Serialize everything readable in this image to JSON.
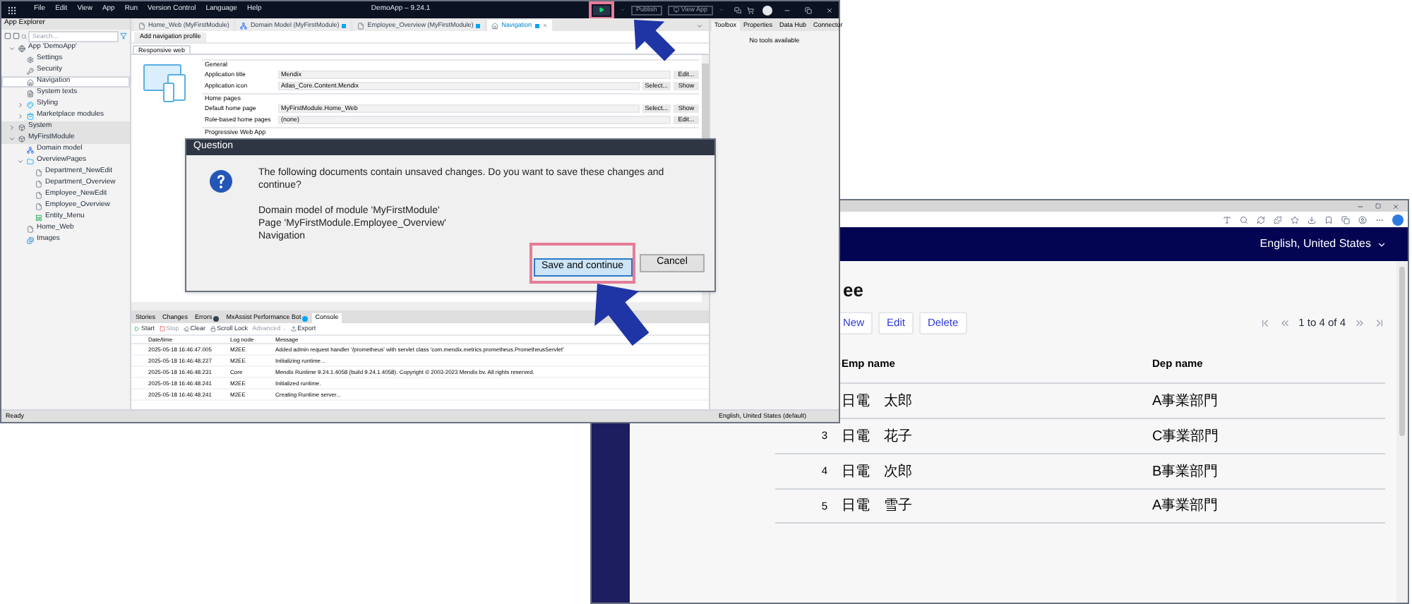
{
  "studio": {
    "title": "DemoApp – 9.24.1",
    "menu": [
      "File",
      "Edit",
      "View",
      "App",
      "Run",
      "Version Control",
      "Language",
      "Help"
    ],
    "publish": "Publish",
    "view_app": "View App",
    "explorer": {
      "title": "App Explorer",
      "search": {
        "placeholder": "Search..."
      },
      "tree": [
        {
          "label": "App 'DemoApp'",
          "kind": "app",
          "expanded": true,
          "selected": false,
          "children": [
            {
              "label": "Settings",
              "kind": "settings",
              "selected": false
            },
            {
              "label": "Security",
              "kind": "security",
              "selected": false
            },
            {
              "label": "Navigation",
              "kind": "navigation",
              "selected": true
            },
            {
              "label": "System texts",
              "kind": "texts",
              "selected": false
            },
            {
              "label": "Styling",
              "kind": "styling",
              "expanded": false,
              "selected": false
            },
            {
              "label": "Marketplace modules",
              "kind": "marketplace",
              "expanded": false,
              "selected": false
            }
          ]
        },
        {
          "label": "System",
          "kind": "module",
          "expanded": false,
          "selected": false
        },
        {
          "label": "MyFirstModule",
          "kind": "module",
          "expanded": true,
          "selected": false,
          "children": [
            {
              "label": "Domain model",
              "kind": "domain",
              "selected": false
            },
            {
              "label": "OverviewPages",
              "kind": "folder",
              "expanded": true,
              "selected": false,
              "children": [
                {
                  "label": "Department_NewEdit",
                  "kind": "page",
                  "selected": false
                },
                {
                  "label": "Department_Overview",
                  "kind": "page",
                  "selected": false
                },
                {
                  "label": "Employee_NewEdit",
                  "kind": "page",
                  "selected": false
                },
                {
                  "label": "Employee_Overview",
                  "kind": "page",
                  "selected": false
                },
                {
                  "label": "Entity_Menu",
                  "kind": "layout",
                  "selected": false
                }
              ]
            },
            {
              "label": "Home_Web",
              "kind": "page",
              "selected": false
            },
            {
              "label": "Images",
              "kind": "images",
              "selected": false
            }
          ]
        }
      ]
    },
    "tabs": [
      {
        "label": "Home_Web (MyFirstModule)",
        "kind": "page",
        "selected": false,
        "unsaved": false
      },
      {
        "label": "Domain Model (MyFirstModule)",
        "kind": "domain",
        "selected": false,
        "unsaved": true
      },
      {
        "label": "Employee_Overview (MyFirstModule)",
        "kind": "page",
        "selected": false,
        "unsaved": true
      },
      {
        "label": "Navigation",
        "kind": "navigation",
        "selected": true,
        "unsaved": true
      }
    ],
    "editor": {
      "add_profile": "Add navigation profile",
      "profile_tabs": [
        {
          "label": "Responsive web",
          "selected": true
        }
      ],
      "groups": [
        {
          "title": "General",
          "rows": [
            {
              "label": "Application title",
              "value": "Mendix",
              "buttons": [
                "Edit..."
              ]
            },
            {
              "label": "Application icon",
              "value": "Atlas_Core.Content.Mendix",
              "buttons": [
                "Select...",
                "Show"
              ]
            }
          ]
        },
        {
          "title": "Home pages",
          "rows": [
            {
              "label": "Default home page",
              "value": "MyFirstModule.Home_Web",
              "buttons": [
                "Select...",
                "Show"
              ]
            },
            {
              "label": "Role-based home pages",
              "value": "(none)",
              "buttons": [
                "Edit..."
              ]
            }
          ]
        },
        {
          "title": "Progressive Web App"
        }
      ]
    },
    "bottom": {
      "tabs": [
        {
          "label": "Stories",
          "kind": "plain",
          "selected": false
        },
        {
          "label": "Changes",
          "kind": "plain",
          "selected": false
        },
        {
          "label": "Errors",
          "kind": "errors",
          "selected": false
        },
        {
          "label": "MxAssist Performance Bot",
          "kind": "bot",
          "selected": false
        },
        {
          "label": "Console",
          "kind": "plain",
          "selected": true
        }
      ],
      "actions": [
        {
          "label": "Start",
          "kind": "start",
          "disabled": false
        },
        {
          "label": "Stop",
          "kind": "stop",
          "disabled": true
        },
        {
          "label": "Clear",
          "kind": "clear",
          "disabled": false
        },
        {
          "label": "Scroll Lock",
          "kind": "lock",
          "disabled": false
        },
        {
          "label": "Advanced",
          "kind": "menu",
          "disabled": true
        },
        {
          "label": "Export",
          "kind": "export",
          "disabled": false
        }
      ],
      "columns": [
        "Date/time",
        "Log node",
        "Message"
      ],
      "rows": [
        [
          "2025-05-18 16:46:47.005",
          "M2EE",
          "Added admin request handler '/prometheus' with servlet class 'com.mendix.metrics.prometheus.PrometheusServlet'"
        ],
        [
          "2025-05-18 16:46:48.227",
          "M2EE",
          "Initializing runtime..."
        ],
        [
          "2025-05-18 16:46:48.231",
          "Core",
          "Mendix Runtime 9.24.1.4058 (build 9.24.1.4058). Copyright © 2003-2023 Mendix bv. All rights reserved."
        ],
        [
          "2025-05-18 16:46:48.241",
          "M2EE",
          "Initialized runtime."
        ],
        [
          "2025-05-18 16:46:48.241",
          "M2EE",
          "Creating Runtime server..."
        ]
      ]
    },
    "right_panel": {
      "tabs": [
        {
          "label": "Toolbox",
          "selected": true
        },
        {
          "label": "Properties",
          "selected": false
        },
        {
          "label": "Data Hub",
          "selected": false
        },
        {
          "label": "Connector",
          "selected": false
        }
      ],
      "empty": "No tools available"
    },
    "status": {
      "left": "Ready",
      "right": "English, United States (default)"
    }
  },
  "dialog": {
    "title": "Question",
    "message": "The following documents contain unsaved changes. Do you want to save these changes and continue?",
    "documents": [
      "Domain model of module 'MyFirstModule'",
      "Page 'MyFirstModule.Employee_Overview'",
      "Navigation"
    ],
    "buttons": [
      {
        "label": "Save and continue",
        "selected": true
      },
      {
        "label": "Cancel",
        "selected": false
      }
    ]
  },
  "browser": {
    "language": "English, United States",
    "title": "ee",
    "actions": [
      "New",
      "Edit",
      "Delete"
    ],
    "pager": "1 to 4 of 4",
    "columns": [
      "Emp name",
      "Dep name"
    ],
    "rows": [
      {
        "emp": "日電　太郎",
        "dep": "A事業部門"
      },
      {
        "number": "3",
        "emp": "日電　花子",
        "dep": "C事業部門"
      },
      {
        "number": "4",
        "emp": "日電　次郎",
        "dep": "B事業部門"
      },
      {
        "number": "5",
        "emp": "日電　雪子",
        "dep": "A事業部門"
      }
    ]
  }
}
